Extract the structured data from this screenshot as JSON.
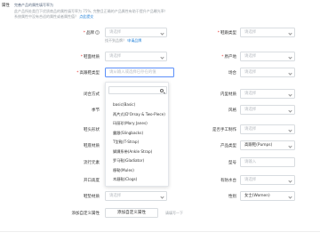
{
  "header": {
    "attr_label": "属性",
    "notice_line1_lead": "完善产品的属性填写率为",
    "notice_line1_text": "此产品所处类目下优质商品的属性填写率为 75%, 完整且正确的产品属性有助于提升产品曝光率！",
    "notice_line2": "系统属性中没有合适的属性或者属性值？",
    "notice_line2_link": "点此提交"
  },
  "left_fields": [
    {
      "label": "品牌",
      "required": true,
      "help": true,
      "value": "请选择"
    },
    {
      "label": "鞋面材质",
      "required": true,
      "help": false,
      "value": "请选择"
    },
    {
      "label": "高跟鞋类型",
      "required": true,
      "help": false,
      "value": "请从输入或选择已存在的值"
    },
    {
      "label": "闭合方式",
      "required": false,
      "help": false,
      "value": "请选择"
    },
    {
      "label": "季节",
      "required": false,
      "help": false,
      "value": "请选择"
    },
    {
      "label": "鞋头形状",
      "required": false,
      "help": false,
      "value": "请选择"
    },
    {
      "label": "鞋底材质",
      "required": false,
      "help": false,
      "value": "请选择"
    },
    {
      "label": "流行元素",
      "required": false,
      "help": false,
      "value": "请选择"
    },
    {
      "label": "开口高度",
      "required": false,
      "help": false,
      "value": "请选择"
    },
    {
      "label": "鞋垫材质",
      "required": false,
      "help": false,
      "value": "请选择"
    }
  ],
  "brand_hint": "找不到品牌？",
  "brand_hint_link": "申请品牌",
  "right_fields": [
    {
      "label": "鞋跟类型",
      "required": true,
      "value": "请选择",
      "filled": false
    },
    {
      "label": "原产地",
      "required": true,
      "value": "请选择",
      "filled": false
    },
    {
      "label": "场合",
      "required": false,
      "value": "请选择",
      "filled": false
    },
    {
      "label": "内里材质",
      "required": false,
      "value": "请选择",
      "filled": false
    },
    {
      "label": "风格",
      "required": false,
      "value": "请选择",
      "filled": false
    },
    {
      "label": "是否手工制作",
      "required": false,
      "value": "请选择",
      "filled": false
    },
    {
      "label": "产品类型",
      "required": false,
      "value": "高跟鞋(Pumps)",
      "filled": true
    },
    {
      "label": "型号",
      "required": false,
      "value": "请输入",
      "filled": false
    },
    {
      "label": "有防水台",
      "required": false,
      "value": "请选择",
      "filled": false
    },
    {
      "label": "性别",
      "required": false,
      "value": "女士(Women)",
      "filled": true
    }
  ],
  "dropdown": {
    "search_placeholder": "",
    "options": [
      "basic(Basic)",
      "两片式(D'Orsay & Two-Piece)",
      "玛丽珍(Mary Janes)",
      "露跟(Slingbacks)",
      "T型鞋(T-Strap)",
      "脚踝系带(Ankle Strap)",
      "罗马鞋(Gladiator)",
      "穆勒(Mules)",
      "木屐鞋(Clogs)"
    ]
  },
  "custom_attr": {
    "label": "添加自定义属性",
    "button": "添加自定义属性",
    "limit": "请填写一下"
  }
}
